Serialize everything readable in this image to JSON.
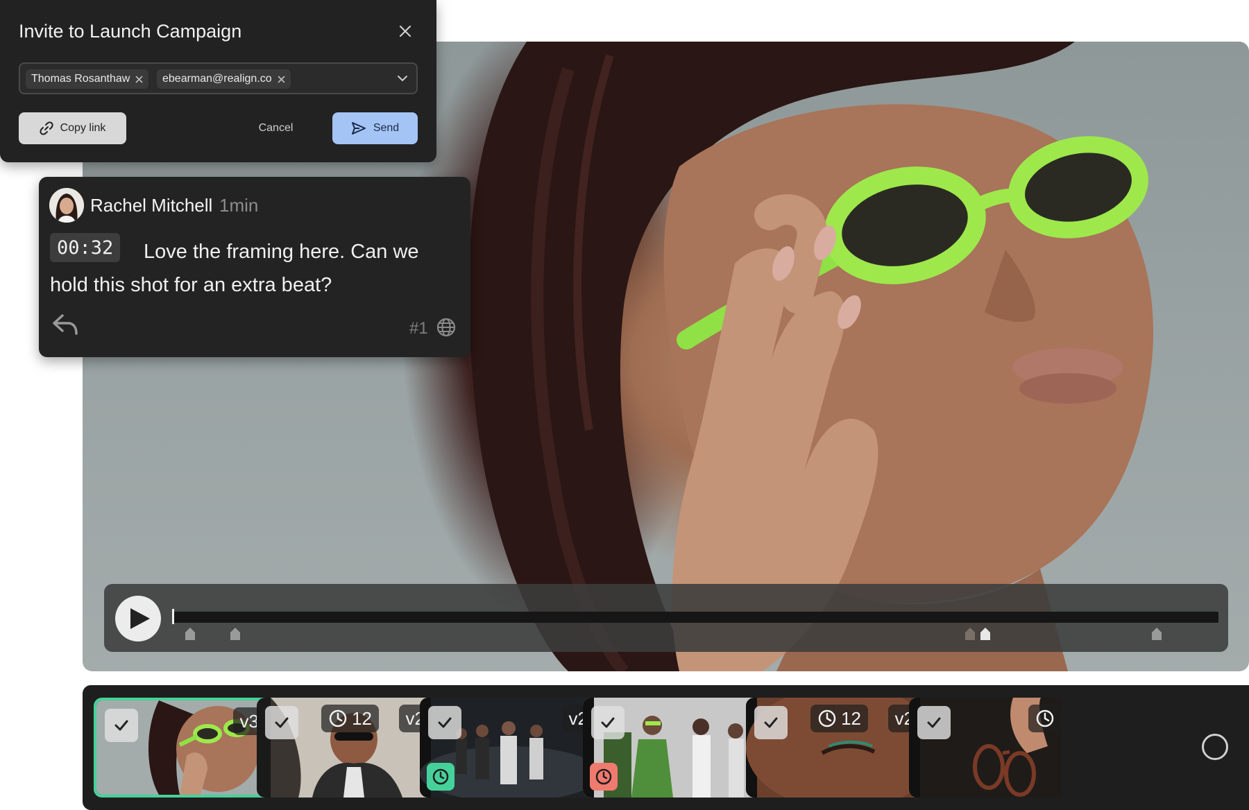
{
  "invite": {
    "title": "Invite to Launch Campaign",
    "chips": [
      "Thomas Rosanthaw",
      "ebearman@realign.co"
    ],
    "copy_link_label": "Copy link",
    "cancel_label": "Cancel",
    "send_label": "Send"
  },
  "comment": {
    "author": "Rachel Mitchell",
    "time_ago": "1min",
    "timestamp": "00:32",
    "text": "Love the framing here. Can we hold this shot for an extra beat?",
    "number": "#1"
  },
  "player": {
    "progress": 0.0
  },
  "filmstrip": {
    "thumbs": [
      {
        "version": "v3",
        "comments": ""
      },
      {
        "version": "v2",
        "comments": "12"
      },
      {
        "version": "v2",
        "comments": ""
      },
      {
        "version": "",
        "comments": ""
      },
      {
        "version": "v2",
        "comments": "12"
      },
      {
        "version": "",
        "comments": ""
      }
    ]
  },
  "colors": {
    "accent_green": "#45d29a",
    "status_red": "#f07a6e",
    "send_blue": "#a4c4f6"
  },
  "icons": [
    "close-icon",
    "chevron-down-icon",
    "link-icon",
    "send-icon",
    "reply-icon",
    "globe-icon",
    "play-icon",
    "check-icon",
    "clock-icon"
  ]
}
